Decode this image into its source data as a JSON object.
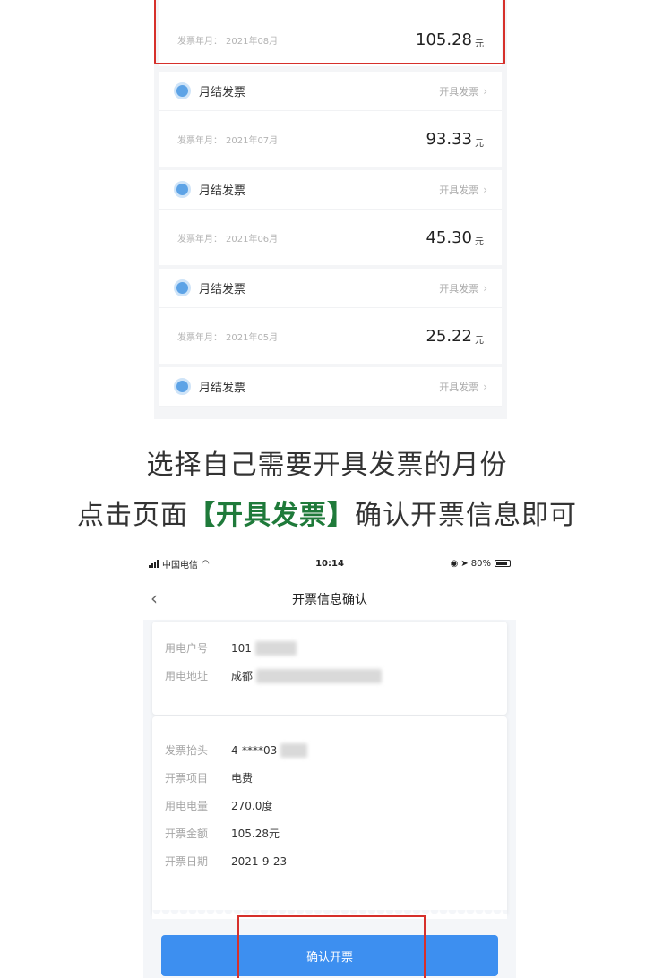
{
  "invoice_list": {
    "top_partial": {
      "label": "发票年月：",
      "month": "2021年08月",
      "amount": "105.28",
      "unit": "元"
    },
    "cards": [
      {
        "title": "月结发票",
        "action": "开具发票",
        "label": "发票年月：",
        "month": "2021年07月",
        "amount": "93.33",
        "unit": "元"
      },
      {
        "title": "月结发票",
        "action": "开具发票",
        "label": "发票年月：",
        "month": "2021年06月",
        "amount": "45.30",
        "unit": "元"
      },
      {
        "title": "月结发票",
        "action": "开具发票",
        "label": "发票年月：",
        "month": "2021年05月",
        "amount": "25.22",
        "unit": "元"
      },
      {
        "title": "月结发票",
        "action": "开具发票"
      }
    ]
  },
  "caption": {
    "line1": "选择自己需要开具发票的月份",
    "line2_prefix": "点击页面",
    "line2_highlight": "【开具发票】",
    "line2_suffix": "确认开票信息即可"
  },
  "status_bar": {
    "carrier": "中国电信",
    "time": "10:14",
    "battery": "80%"
  },
  "confirm_page": {
    "title": "开票信息确认",
    "account": [
      {
        "key": "用电户号",
        "value": "101"
      },
      {
        "key": "用电地址",
        "value": "成都"
      }
    ],
    "invoice": [
      {
        "key": "发票抬头",
        "value": "4-****03"
      },
      {
        "key": "开票项目",
        "value": "电费"
      },
      {
        "key": "用电电量",
        "value": "270.0度"
      },
      {
        "key": "开票金额",
        "value": "105.28元"
      },
      {
        "key": "开票日期",
        "value": "2021-9-23"
      }
    ],
    "confirm_label": "确认开票"
  },
  "colors": {
    "highlight_green": "#1f7a3a",
    "annotation_red": "#d6302b",
    "button_blue": "#3d8ff0"
  }
}
